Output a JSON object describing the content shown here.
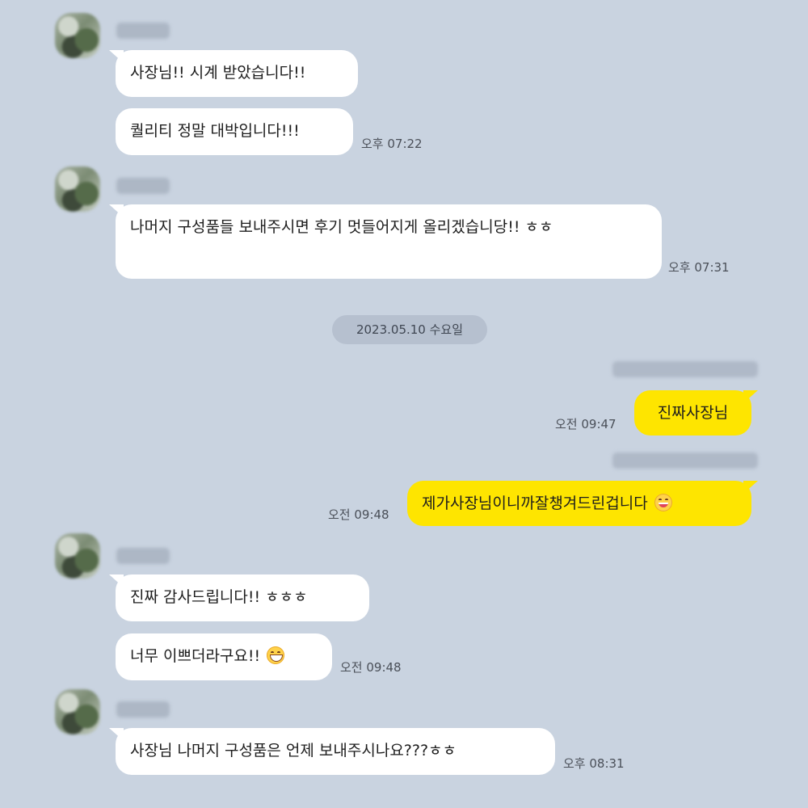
{
  "messages": {
    "m1": "사장님!! 시계 받았습니다!!",
    "m2": "퀄리티 정말 대박입니다!!!",
    "m2_time": "오후 07:22",
    "m3": "나머지 구성품들 보내주시면 후기 멋들어지게 올리겠습니당!! ㅎㅎ",
    "m3_time": "오후 07:31",
    "date_divider": "2023.05.10 수요일",
    "m4": "진짜사장님",
    "m4_time": "오전 09:47",
    "m5": "제가사장님이니까잘챙겨드린겁니다",
    "m5_time": "오전 09:48",
    "m6": "진짜 감사드립니다!! ㅎㅎㅎ",
    "m7": "너무 이쁘더라구요!!",
    "m7_time": "오전 09:48",
    "m8": "사장님 나머지 구성품은 언제 보내주시나요???ㅎㅎ",
    "m8_time": "오후 08:31"
  },
  "icons": {
    "smile_emoji": "smiling-face-emoji",
    "grin_emoji": "grinning-face-emoji"
  },
  "colors": {
    "background": "#c9d3e0",
    "incoming_bubble": "#ffffff",
    "outgoing_bubble": "#fee500"
  }
}
